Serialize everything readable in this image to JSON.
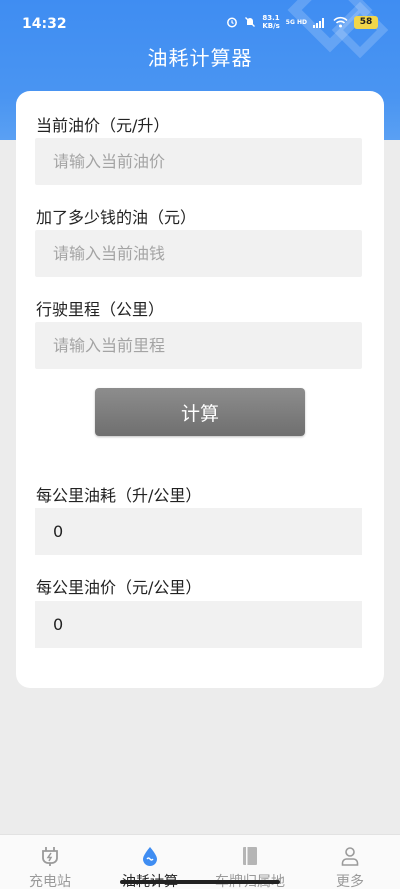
{
  "status": {
    "time": "14:32",
    "speed_value": "83.1",
    "speed_unit": "KB/s",
    "network": "5G HD",
    "battery": "58"
  },
  "header": {
    "title": "油耗计算器"
  },
  "form": {
    "price_label": "当前油价（元/升）",
    "price_placeholder": "请输入当前油价",
    "money_label": "加了多少钱的油（元）",
    "money_placeholder": "请输入当前油钱",
    "distance_label": "行驶里程（公里）",
    "distance_placeholder": "请输入当前里程",
    "calc_button": "计算"
  },
  "results": {
    "consumption_label": "每公里油耗（升/公里）",
    "consumption_value": "0",
    "cost_label": "每公里油价（元/公里）",
    "cost_value": "0"
  },
  "nav": {
    "items": [
      {
        "label": "充电站",
        "icon": "charging-plug-icon"
      },
      {
        "label": "油耗计算",
        "icon": "fuel-drop-icon"
      },
      {
        "label": "车牌归属地",
        "icon": "book-icon"
      },
      {
        "label": "更多",
        "icon": "person-icon"
      }
    ],
    "active_index": 1,
    "active_color": "#222222",
    "inactive_color": "#9a9a9a",
    "accent": "#3f8df2"
  }
}
